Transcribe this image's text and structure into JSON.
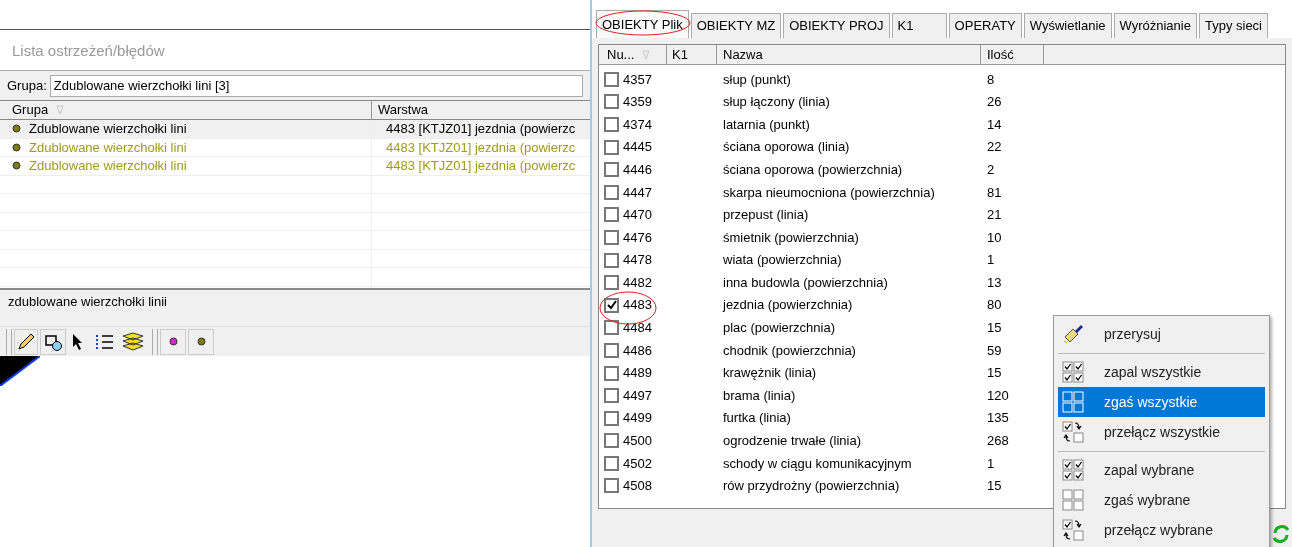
{
  "warnings_panel": {
    "title": "Lista ostrzeżeń/błędów",
    "group_label": "Grupa:",
    "group_value": "Zdublowane wierzchołki lini [3]",
    "columns": [
      "Grupa",
      "Warstwa"
    ],
    "rows": [
      {
        "group": "Zdublowane wierzchołki lini",
        "layer": "4483 [KTJZ01] jezdnia (powierzc",
        "selected": true
      },
      {
        "group": "Zdublowane wierzchołki lini",
        "layer": "4483 [KTJZ01] jezdnia (powierzc",
        "selected": false
      },
      {
        "group": "Zdublowane wierzchołki lini",
        "layer": "4483 [KTJZ01] jezdnia (powierzc",
        "selected": false
      }
    ],
    "description": "zdublowane wierzchołki linii"
  },
  "tabs": [
    {
      "label": "OBIEKTY Plik",
      "selected": true
    },
    {
      "label": "OBIEKTY MZ",
      "selected": false
    },
    {
      "label": "OBIEKTY PROJ",
      "selected": false
    },
    {
      "label": "K1",
      "selected": false
    },
    {
      "label": "OPERATY",
      "selected": false
    },
    {
      "label": "Wyświetlanie",
      "selected": false
    },
    {
      "label": "Wyróżnianie",
      "selected": false
    },
    {
      "label": "Typy sieci",
      "selected": false
    }
  ],
  "objects_table": {
    "columns": [
      "Nu...",
      "K1",
      "Nazwa",
      "Ilość"
    ],
    "rows": [
      {
        "number": "4357",
        "name": "słup (punkt)",
        "count": "8",
        "checked": false
      },
      {
        "number": "4359",
        "name": "słup łączony (linia)",
        "count": "26",
        "checked": false
      },
      {
        "number": "4374",
        "name": "latarnia (punkt)",
        "count": "14",
        "checked": false
      },
      {
        "number": "4445",
        "name": "ściana oporowa (linia)",
        "count": "22",
        "checked": false
      },
      {
        "number": "4446",
        "name": "ściana oporowa (powierzchnia)",
        "count": "2",
        "checked": false
      },
      {
        "number": "4447",
        "name": "skarpa nieumocniona (powierzchnia)",
        "count": "81",
        "checked": false
      },
      {
        "number": "4470",
        "name": "przepust (linia)",
        "count": "21",
        "checked": false
      },
      {
        "number": "4476",
        "name": "śmietnik (powierzchnia)",
        "count": "10",
        "checked": false
      },
      {
        "number": "4478",
        "name": "wiata (powierzchnia)",
        "count": "1",
        "checked": false
      },
      {
        "number": "4482",
        "name": "inna budowla (powierzchnia)",
        "count": "13",
        "checked": false
      },
      {
        "number": "4483",
        "name": "jezdnia (powierzchnia)",
        "count": "80",
        "checked": true
      },
      {
        "number": "4484",
        "name": "plac (powierzchnia)",
        "count": "15",
        "checked": false
      },
      {
        "number": "4486",
        "name": "chodnik (powierzchnia)",
        "count": "59",
        "checked": false
      },
      {
        "number": "4489",
        "name": "krawężnik (linia)",
        "count": "15",
        "checked": false
      },
      {
        "number": "4497",
        "name": "brama (linia)",
        "count": "120",
        "checked": false
      },
      {
        "number": "4499",
        "name": "furtka (linia)",
        "count": "135",
        "checked": false
      },
      {
        "number": "4500",
        "name": "ogrodzenie trwałe (linia)",
        "count": "268",
        "checked": false
      },
      {
        "number": "4502",
        "name": "schody w ciągu komunikacyjnym",
        "count": "1",
        "checked": false
      },
      {
        "number": "4508",
        "name": "rów przydrożny (powierzchnia)",
        "count": "15",
        "checked": false
      }
    ]
  },
  "context_menu": {
    "groups": [
      [
        {
          "label": "przerysuj",
          "kind": "brush",
          "selected": false
        }
      ],
      [
        {
          "label": "zapal wszystkie",
          "kind": "check_all",
          "selected": false
        },
        {
          "label": "zgaś wszystkie",
          "kind": "uncheck_all",
          "selected": true
        },
        {
          "label": "przełącz wszystkie",
          "kind": "toggle",
          "selected": false
        }
      ],
      [
        {
          "label": "zapal wybrane",
          "kind": "check_all",
          "selected": false
        },
        {
          "label": "zgaś wybrane",
          "kind": "uncheck_all",
          "selected": false
        },
        {
          "label": "przełącz wybrane",
          "kind": "toggle",
          "selected": false
        }
      ]
    ]
  }
}
